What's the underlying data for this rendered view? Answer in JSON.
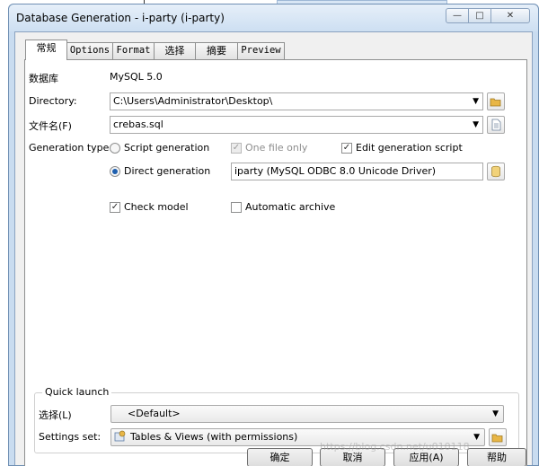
{
  "window": {
    "title": "Database Generation - i-party (i-party)",
    "controls": {
      "minimize": "—",
      "maximize": "□",
      "close": "✕"
    }
  },
  "tabs": [
    {
      "label": "常规",
      "active": true
    },
    {
      "label": "Options",
      "active": false
    },
    {
      "label": "Format",
      "active": false
    },
    {
      "label": "选择",
      "active": false
    },
    {
      "label": "摘要",
      "active": false
    },
    {
      "label": "Preview",
      "active": false
    }
  ],
  "general": {
    "dbms_label": "数据库",
    "dbms_value": "MySQL 5.0",
    "directory_label": "Directory:",
    "directory_value": "C:\\Users\\Administrator\\Desktop\\",
    "filename_label": "文件名(F)",
    "filename_value": "crebas.sql",
    "gentype_label": "Generation type:",
    "script_generation_label": "Script generation",
    "direct_generation_label": "Direct generation",
    "one_file_only_label": "One file only",
    "edit_script_label": "Edit generation script",
    "datasource_value": "iparty (MySQL ODBC 8.0 Unicode Driver)",
    "check_model_label": "Check model",
    "auto_archive_label": "Automatic archive"
  },
  "state": {
    "generation_type": "direct",
    "one_file_only": true,
    "one_file_only_enabled": false,
    "edit_generation_script": true,
    "check_model": true,
    "automatic_archive": false
  },
  "quick_launch": {
    "title": "Quick launch",
    "selection_label": "选择(L)",
    "selection_value": "<Default>",
    "settings_label": "Settings set:",
    "settings_value": "Tables & Views (with permissions)"
  },
  "buttons": {
    "ok": "确定",
    "cancel": "取消",
    "apply": "应用(A)",
    "help": "帮助"
  },
  "icons": {
    "browse_folder": "folder-icon",
    "edit_file": "document-icon",
    "datasource": "database-icon",
    "settings": "settings-set-icon"
  },
  "colors": {
    "title_bar": "#cddff2",
    "radio_selected": "#1f5fae",
    "folder_yellow": "#e8b646"
  },
  "watermark": "https://blog.csdn.net/u010118"
}
